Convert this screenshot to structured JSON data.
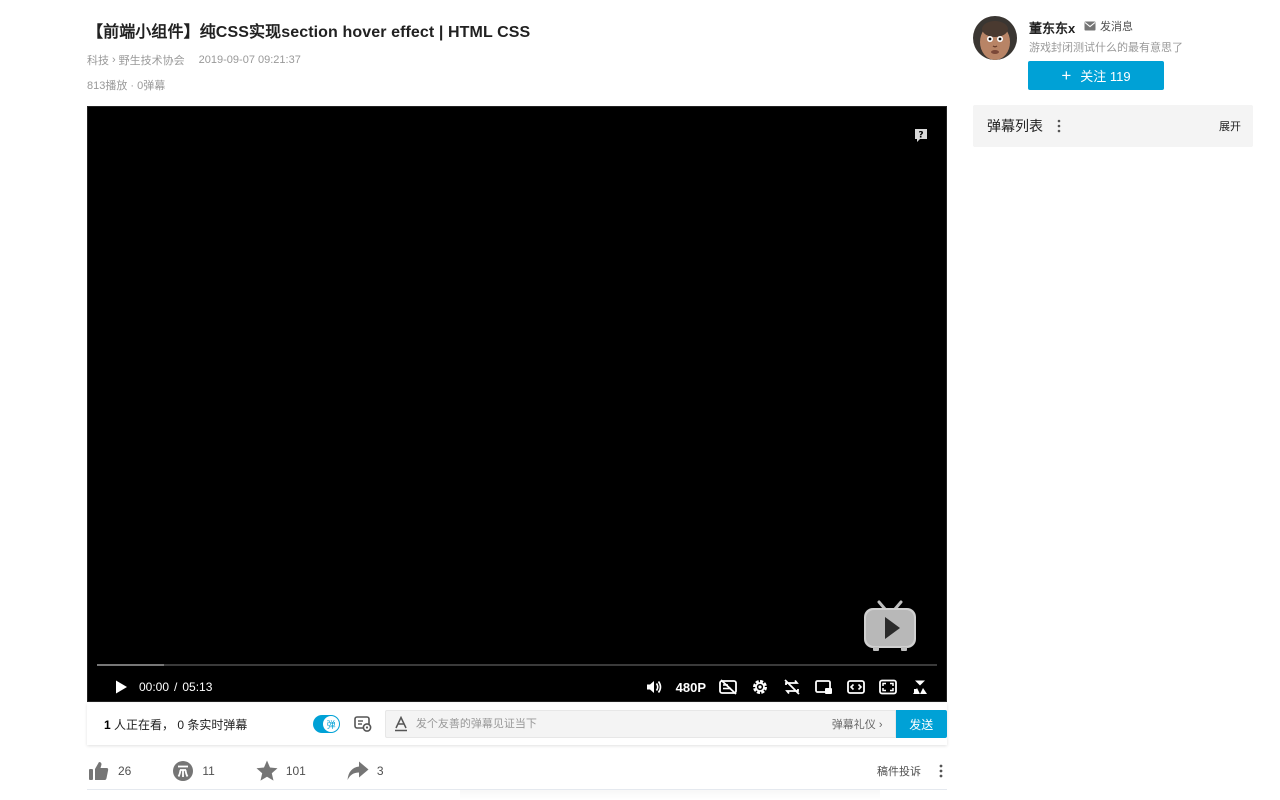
{
  "video": {
    "title": "【前端小组件】纯CSS实现section hover effect | HTML CSS",
    "category": "科技",
    "subcategory": "野生技术协会",
    "breadcrumb_sep": "›",
    "date": "2019-09-07 09:21:37",
    "stats": "813播放 · 0弹幕"
  },
  "player": {
    "current_time": "00:00",
    "time_sep": "/",
    "duration": "05:13",
    "quality": "480P",
    "buffered_fraction": 0.08,
    "icons": [
      "play-icon",
      "volume-icon",
      "danmaku-off-icon",
      "settings-icon",
      "loop-icon",
      "pip-icon",
      "wide-mode-icon",
      "web-fullscreen-icon",
      "fullscreen-icon",
      "help-icon",
      "big-play-icon"
    ]
  },
  "sendbar": {
    "watching_count": "1",
    "watching_text": " 人正在看， 0 条实时弹幕",
    "toggle_label": "弹",
    "placeholder": "发个友善的弹幕见证当下",
    "etiquette": "弹幕礼仪 ›",
    "send_label": "发送"
  },
  "actions": {
    "like": "26",
    "coin": "11",
    "favorite": "101",
    "share": "3",
    "report": "稿件投诉"
  },
  "uploader": {
    "name": "董东东x",
    "message_label": "发消息",
    "signature": "游戏封闭测试什么的最有意思了",
    "follow_plus": "+",
    "follow_label": "关注 119"
  },
  "danmaku_list": {
    "label": "弹幕列表",
    "expand": "展开"
  },
  "colors": {
    "accent": "#00a1d6",
    "player_bg": "#000000",
    "panel_bg": "#f4f4f4"
  }
}
